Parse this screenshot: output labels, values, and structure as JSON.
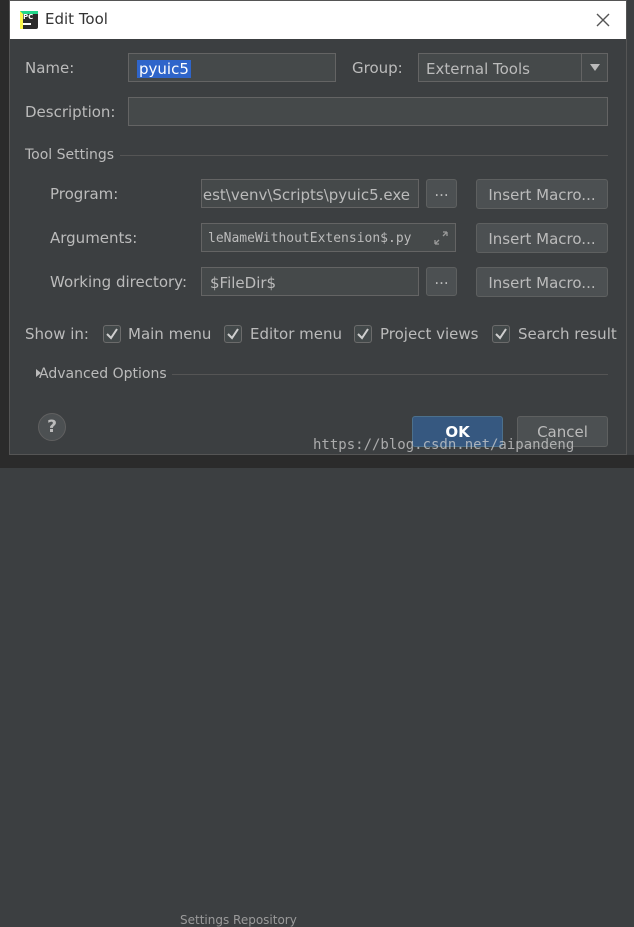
{
  "dialog": {
    "title": "Edit Tool",
    "app_badge": "PC"
  },
  "form": {
    "name_label": "Name:",
    "name_value": "pyuic5",
    "group_label": "Group:",
    "group_value": "External Tools",
    "description_label": "Description:",
    "description_value": ""
  },
  "tool_settings": {
    "section_label": "Tool Settings",
    "program_label": "Program:",
    "program_value": "est\\venv\\Scripts\\pyuic5.exe",
    "arguments_label": "Arguments:",
    "arguments_value": "leNameWithoutExtension$.py",
    "working_dir_label": "Working directory:",
    "working_dir_value": "$FileDir$",
    "browse_label": "...",
    "insert_macro_label": "Insert Macro..."
  },
  "show_in": {
    "label": "Show in:",
    "options": [
      {
        "label": "Main menu",
        "checked": true
      },
      {
        "label": "Editor menu",
        "checked": true
      },
      {
        "label": "Project views",
        "checked": true
      },
      {
        "label": "Search result",
        "checked": true
      }
    ]
  },
  "advanced": {
    "label": "Advanced Options"
  },
  "footer": {
    "help_label": "?",
    "ok_label": "OK",
    "cancel_label": "Cancel"
  },
  "background": {
    "bottom_text": "Settings Repository"
  },
  "watermark": "https://blog.csdn.net/aipandeng",
  "colors": {
    "accent": "#2f65ca",
    "ok_button": "#365880",
    "dialog_bg": "#3c3f41"
  }
}
